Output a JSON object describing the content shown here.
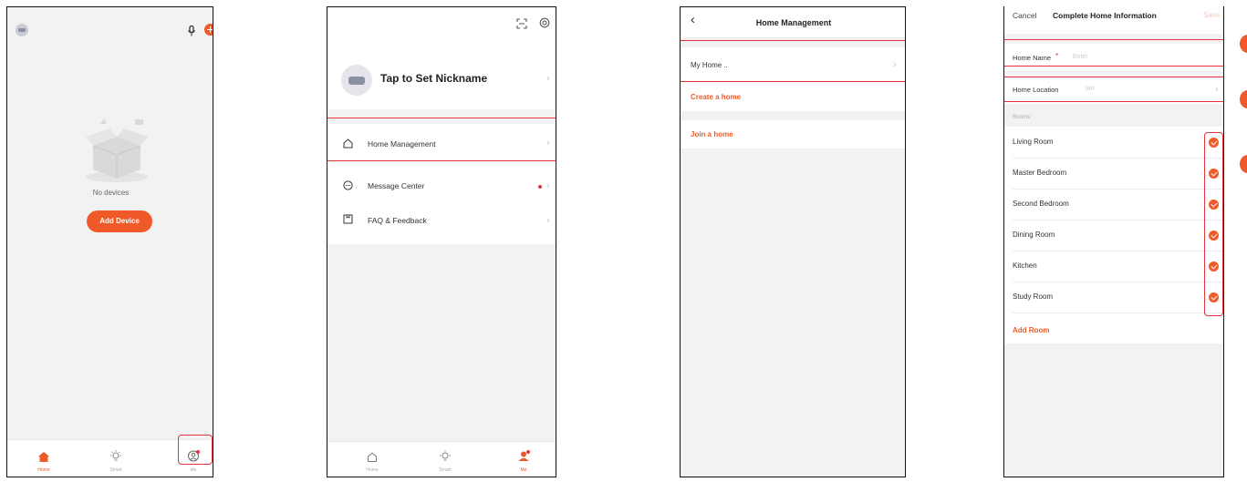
{
  "screen_home": {
    "empty_text": "No devices",
    "add_device_label": "Add Device",
    "tabs": [
      {
        "label": "Home"
      },
      {
        "label": "Smart"
      },
      {
        "label": "Me"
      }
    ]
  },
  "screen_me": {
    "nickname": "Tap to Set Nickname",
    "menu": [
      {
        "label": "Home Management"
      },
      {
        "label": "Message Center"
      },
      {
        "label": "FAQ & Feedback"
      }
    ],
    "tabs": [
      {
        "label": "Home"
      },
      {
        "label": "Smart"
      },
      {
        "label": "Me"
      }
    ]
  },
  "screen_home_mgmt": {
    "title": "Home Management",
    "my_home": "My Home ..",
    "create_home": "Create a home",
    "join_home": "Join a home"
  },
  "screen_complete_home": {
    "cancel_label": "Cancel",
    "title": "Complete Home Information",
    "save_label": "Save",
    "home_name_label": "Home Name",
    "home_name_required": "*",
    "home_name_placeholder": "Enter",
    "home_location_label": "Home Location",
    "home_location_placeholder": "Set",
    "rooms_header": "Rooms:",
    "rooms": [
      "Living Room",
      "Master Bedroom",
      "Second Bedroom",
      "Dining Room",
      "Kitchen",
      "Study Room"
    ],
    "add_room_label": "Add Room"
  },
  "colors": {
    "accent": "#f05a28",
    "highlight": "#e8323c",
    "background_grey": "#f2f2f2"
  }
}
